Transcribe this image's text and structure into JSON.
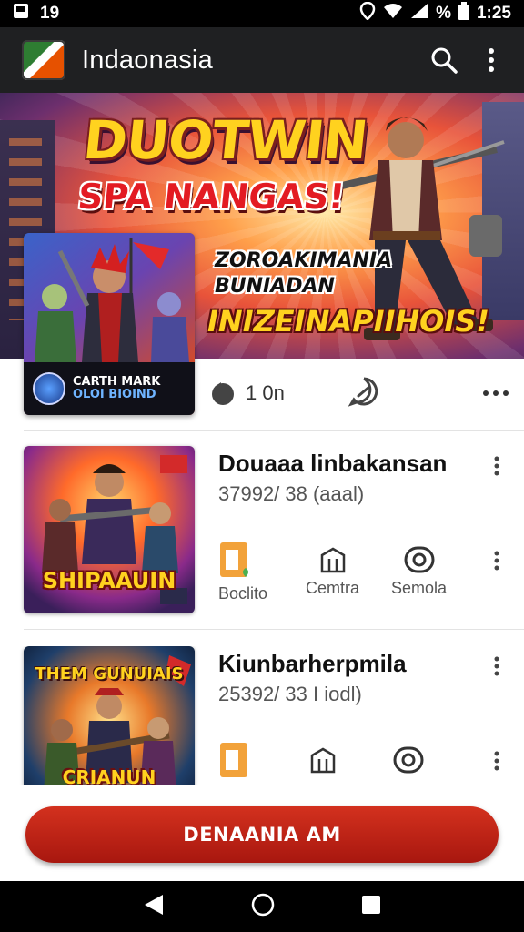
{
  "status_bar": {
    "time": "19",
    "battery": "%",
    "clock": "1:25"
  },
  "app_bar": {
    "title": "Indaonasia",
    "icons": [
      "search-icon",
      "more-vert-icon"
    ]
  },
  "banner": {
    "title": "DUOTWIN",
    "subtitle": "SPA NANGAS!",
    "line1": "ZOROAKIMANIA",
    "line2": "BUNIADAN",
    "line3": "INIZEINAPIIHOIS!"
  },
  "featured": {
    "thumb_line1": "CARTH MARK",
    "thumb_line2": "OLOI BIOIND",
    "likes": "1 0n"
  },
  "items": [
    {
      "title": "Douaaa linbakansan",
      "subtitle": "37992/ 38 (aaal)",
      "thumb_caption": "SHIPAAUIN",
      "action_left_label": "Boclito",
      "action_mid_label": "Cemtra",
      "action_right_label": "Semola"
    },
    {
      "title": "Kiunbarherpmila",
      "subtitle": "25392/ 33 I iodl)",
      "thumb_top": "THEM GUNUIAIS",
      "thumb_caption": "CRIANUN"
    }
  ],
  "cta": {
    "label": "DENAANIA AM"
  },
  "colors": {
    "accent": "#c0261a",
    "appbar": "#1f2022"
  },
  "nav": [
    "back-icon",
    "home-icon",
    "recents-icon"
  ]
}
